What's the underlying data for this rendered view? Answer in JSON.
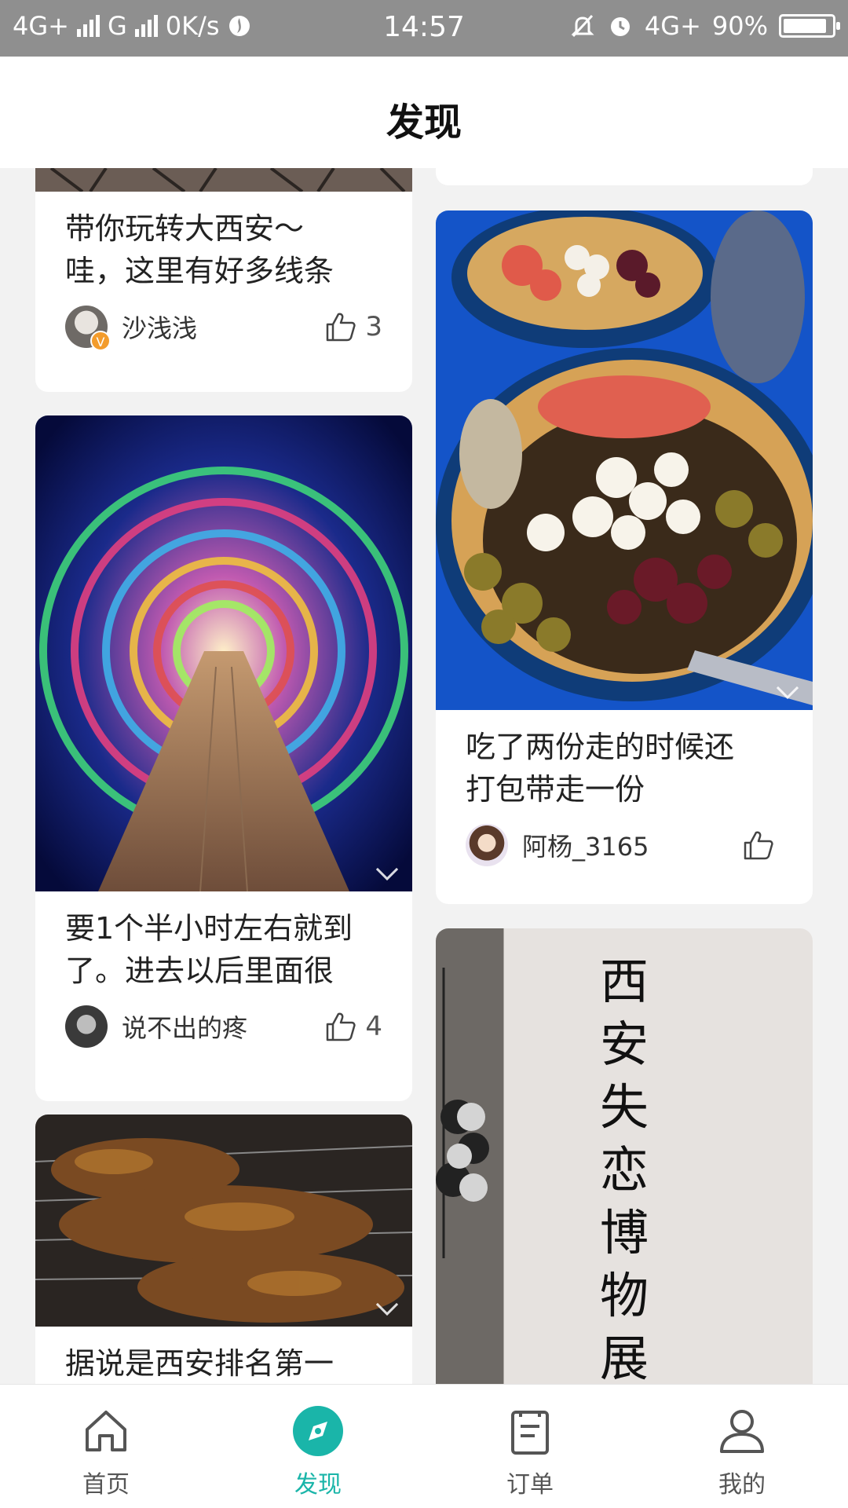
{
  "status_bar": {
    "network1": "4G+",
    "network2": "G",
    "speed": "0K/s",
    "time": "14:57",
    "network3": "4G+",
    "battery": "90%",
    "battery_level": 0.9
  },
  "header": {
    "title": "发现"
  },
  "feed": {
    "left": [
      {
        "caption": "带你玩转大西安～\n哇，这里有好多线条",
        "author": "沙浅浅",
        "likes": "3"
      },
      {
        "caption": "要1个半小时左右就到\n了。进去以后里面很",
        "author": "说不出的疼",
        "likes": "4"
      },
      {
        "caption": "据说是西安排名第一"
      }
    ],
    "right": [
      {
        "caption": "吃了两份走的时候还\n打包带走一份",
        "author": "阿杨_3165",
        "likes": ""
      },
      {
        "sign_text": "西安失恋博物展"
      }
    ]
  },
  "tabbar": {
    "items": [
      {
        "label": "首页",
        "icon": "home-icon"
      },
      {
        "label": "发现",
        "icon": "compass-icon",
        "active": true
      },
      {
        "label": "订单",
        "icon": "order-icon"
      },
      {
        "label": "我的",
        "icon": "profile-icon"
      }
    ],
    "accent": "#1ab5a9"
  }
}
